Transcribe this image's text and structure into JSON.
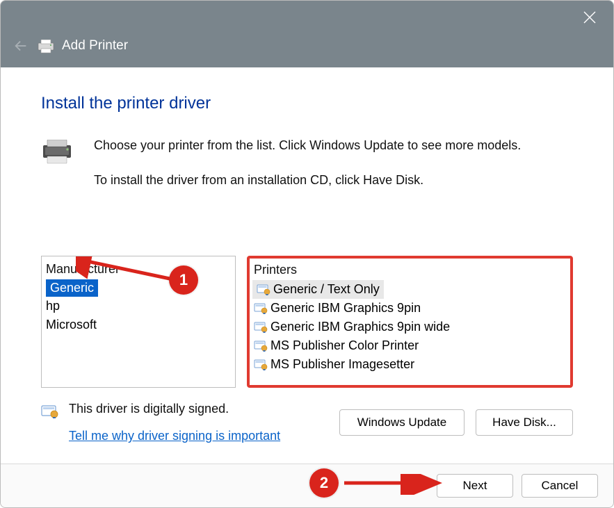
{
  "titlebar": {
    "title": "Add Printer"
  },
  "content": {
    "heading": "Install the printer driver",
    "desc1": "Choose your printer from the list. Click Windows Update to see more models.",
    "desc2": "To install the driver from an installation CD, click Have Disk."
  },
  "manufacturer": {
    "header": "Manufacturer",
    "items": [
      "Generic",
      "hp",
      "Microsoft"
    ],
    "selected": 0
  },
  "printers": {
    "header": "Printers",
    "items": [
      "Generic / Text Only",
      "Generic IBM Graphics 9pin",
      "Generic IBM Graphics 9pin wide",
      "MS Publisher Color Printer",
      "MS Publisher Imagesetter"
    ],
    "selected": 0
  },
  "signed": {
    "text": "This driver is digitally signed.",
    "link": "Tell me why driver signing is important"
  },
  "buttons": {
    "windows_update": "Windows Update",
    "have_disk": "Have Disk...",
    "next": "Next",
    "cancel": "Cancel"
  },
  "annotations": {
    "circle1": "1",
    "circle2": "2"
  }
}
